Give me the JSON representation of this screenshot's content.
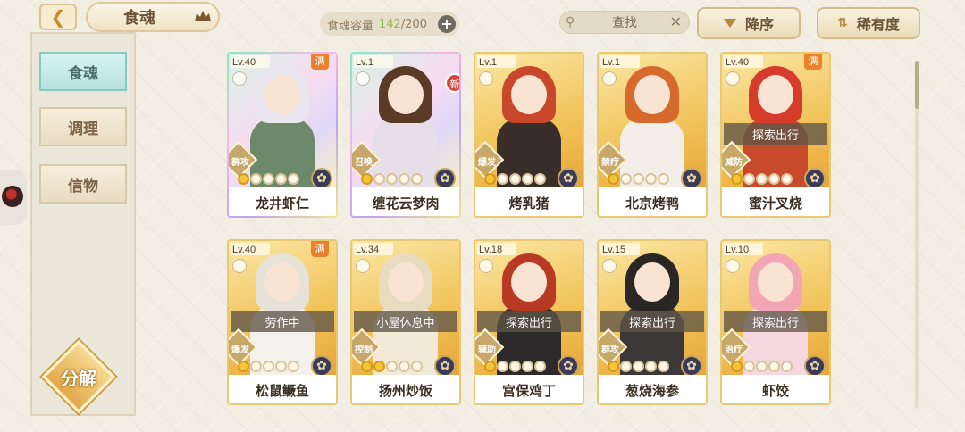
{
  "header": {
    "back_icon": "back-arrow-icon",
    "title": "食魂",
    "hat_icon": "chef-hat-icon",
    "capacity_label": "食魂容量",
    "capacity_current": "142",
    "capacity_max": "/200",
    "capacity_add": "+",
    "search_placeholder": "查找",
    "search_clear": "✕",
    "sort_order": "降序",
    "sort_by": "稀有度"
  },
  "sidebar": {
    "items": [
      {
        "label": "食魂",
        "active": true
      },
      {
        "label": "调理",
        "active": false
      },
      {
        "label": "信物",
        "active": false
      }
    ],
    "decompose_label": "分解"
  },
  "cards": [
    {
      "level": "Lv.40",
      "name": "龙井虾仁",
      "role": "群攻",
      "stars": 1,
      "max": "满",
      "new": "",
      "status": "",
      "style": "rainbow",
      "hair": "#e9e6f0",
      "body": "#6c8a6a"
    },
    {
      "level": "Lv.1",
      "name": "缠花云梦肉",
      "role": "召唤",
      "stars": 1,
      "max": "",
      "new": "新",
      "status": "",
      "style": "rainbow",
      "hair": "#5b3b28",
      "body": "#e6dfe8"
    },
    {
      "level": "Lv.1",
      "name": "烤乳猪",
      "role": "爆发",
      "stars": 1,
      "max": "",
      "new": "",
      "status": "",
      "style": "gold",
      "hair": "#c9482b",
      "body": "#3a2e2a"
    },
    {
      "level": "Lv.1",
      "name": "北京烤鸭",
      "role": "禁疗",
      "stars": 1,
      "max": "",
      "new": "",
      "status": "",
      "style": "gold",
      "hair": "#d56a2c",
      "body": "#f3efe8"
    },
    {
      "level": "Lv.40",
      "name": "蜜汁叉烧",
      "role": "减防",
      "stars": 1,
      "max": "满",
      "new": "",
      "status": "探索出行",
      "style": "gold",
      "hair": "#d63c2c",
      "body": "#c84a2c"
    },
    {
      "level": "Lv.40",
      "name": "松鼠鳜鱼",
      "role": "爆发",
      "stars": 1,
      "max": "满",
      "new": "",
      "status": "劳作中",
      "style": "gold",
      "hair": "#e7e2d8",
      "body": "#f4f1ea"
    },
    {
      "level": "Lv.34",
      "name": "扬州炒饭",
      "role": "控制",
      "stars": 2,
      "max": "",
      "new": "",
      "status": "小屋休息中",
      "style": "gold",
      "hair": "#e8dcc0",
      "body": "#f2ead6"
    },
    {
      "level": "Lv.18",
      "name": "宫保鸡丁",
      "role": "辅助",
      "stars": 1,
      "max": "",
      "new": "",
      "status": "探索出行",
      "style": "gold",
      "hair": "#b83a24",
      "body": "#2d2a2c"
    },
    {
      "level": "Lv.15",
      "name": "葱烧海参",
      "role": "群攻",
      "stars": 1,
      "max": "",
      "new": "",
      "status": "探索出行",
      "style": "gold",
      "hair": "#2a2626",
      "body": "#3c3838"
    },
    {
      "level": "Lv.10",
      "name": "虾饺",
      "role": "治疗",
      "stars": 1,
      "max": "",
      "new": "",
      "status": "探索出行",
      "style": "gold",
      "hair": "#f2a6b4",
      "body": "#f5d7df"
    }
  ],
  "colors": {
    "accent_gold": "#e8c873",
    "active_tab": "#b5e2df",
    "capacity_current": "#8dbb4a"
  }
}
